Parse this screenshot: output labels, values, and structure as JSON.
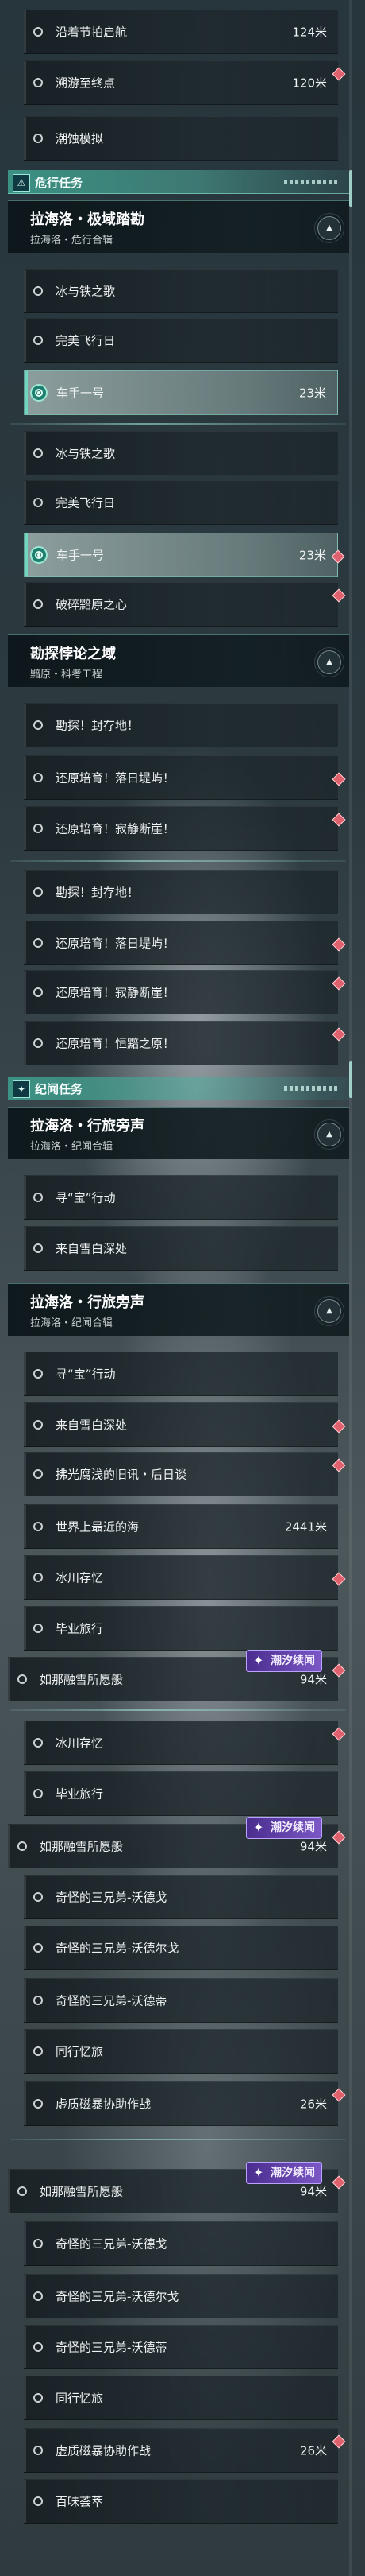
{
  "rows": [
    {
      "id": "r01",
      "label": "沿着节拍启航",
      "dist": "124米"
    },
    {
      "id": "r02",
      "label": "溯游至终点",
      "dist": "120米"
    },
    {
      "id": "r03",
      "label": "潮蚀模拟"
    },
    {
      "id": "r04",
      "label": "冰与铁之歌"
    },
    {
      "id": "r05",
      "label": "完美飞行日"
    },
    {
      "id": "r06",
      "label": "车手一号",
      "dist": "23米"
    },
    {
      "id": "r07",
      "label": "冰与铁之歌"
    },
    {
      "id": "r08",
      "label": "完美飞行日"
    },
    {
      "id": "r09",
      "label": "车手一号",
      "dist": "23米"
    },
    {
      "id": "r10",
      "label": "破碎黯原之心"
    },
    {
      "id": "r11",
      "label": "勘探！封存地！"
    },
    {
      "id": "r12",
      "label": "还原培育！落日堤屿！"
    },
    {
      "id": "r13",
      "label": "还原培育！寂静断崖！"
    },
    {
      "id": "r14",
      "label": "勘探！封存地！"
    },
    {
      "id": "r15",
      "label": "还原培育！落日堤屿！"
    },
    {
      "id": "r16",
      "label": "还原培育！寂静断崖！"
    },
    {
      "id": "r17",
      "label": "还原培育！恒黯之原！"
    },
    {
      "id": "r18",
      "label": "寻“宝”行动"
    },
    {
      "id": "r19",
      "label": "来自雪白深处"
    },
    {
      "id": "r20",
      "label": "寻“宝”行动"
    },
    {
      "id": "r21",
      "label": "来自雪白深处"
    },
    {
      "id": "r22",
      "label": "拂光腐浅的旧讯・后日谈"
    },
    {
      "id": "r23",
      "label": "世界上最近的海",
      "dist": "2441米"
    },
    {
      "id": "r24",
      "label": "冰川存忆"
    },
    {
      "id": "r25",
      "label": "毕业旅行"
    },
    {
      "id": "r26",
      "label": "如那融雪所愿般",
      "dist": "94米",
      "badge": "潮汐续闻"
    },
    {
      "id": "r27",
      "label": "冰川存忆"
    },
    {
      "id": "r28",
      "label": "毕业旅行"
    },
    {
      "id": "r29",
      "label": "如那融雪所愿般",
      "dist": "94米",
      "badge": "潮汐续闻"
    },
    {
      "id": "r30",
      "label": "奇怪的三兄弟-沃德戈"
    },
    {
      "id": "r31",
      "label": "奇怪的三兄弟-沃德尔戈"
    },
    {
      "id": "r32",
      "label": "奇怪的三兄弟-沃德蒂"
    },
    {
      "id": "r33",
      "label": "同行忆旅"
    },
    {
      "id": "r34",
      "label": "虚质磁暴协助作战",
      "dist": "26米"
    },
    {
      "id": "r35",
      "label": "如那融雪所愿般",
      "dist": "94米",
      "badge": "潮汐续闻"
    },
    {
      "id": "r36",
      "label": "奇怪的三兄弟-沃德戈"
    },
    {
      "id": "r37",
      "label": "奇怪的三兄弟-沃德尔戈"
    },
    {
      "id": "r38",
      "label": "奇怪的三兄弟-沃德蒂"
    },
    {
      "id": "r39",
      "label": "同行忆旅"
    },
    {
      "id": "r40",
      "label": "虚质磁暴协助作战",
      "dist": "26米"
    },
    {
      "id": "r41",
      "label": "百味荟萃"
    }
  ],
  "sections": [
    {
      "id": "s1",
      "title": "危行任务",
      "icon": "warning-icon",
      "glyph": "⚠"
    },
    {
      "id": "s2",
      "title": "纪闻任务",
      "icon": "sparkle-icon",
      "glyph": "✦"
    }
  ],
  "groups": [
    {
      "id": "g1",
      "title": "拉海洛・极域踏勘",
      "subtitle": "拉海洛・危行合辑"
    },
    {
      "id": "g2",
      "title": "勘探悖论之域",
      "subtitle": "黯原・科考工程"
    },
    {
      "id": "g3",
      "title": "拉海洛・行旅旁声",
      "subtitle": "拉海洛・纪闻合辑"
    },
    {
      "id": "g4",
      "title": "拉海洛・行旅旁声",
      "subtitle": "拉海洛・纪闻合辑"
    }
  ],
  "colors": {
    "accent": "#6fd6bf",
    "marker": "#e0616e",
    "badge": "#7b58c6"
  }
}
